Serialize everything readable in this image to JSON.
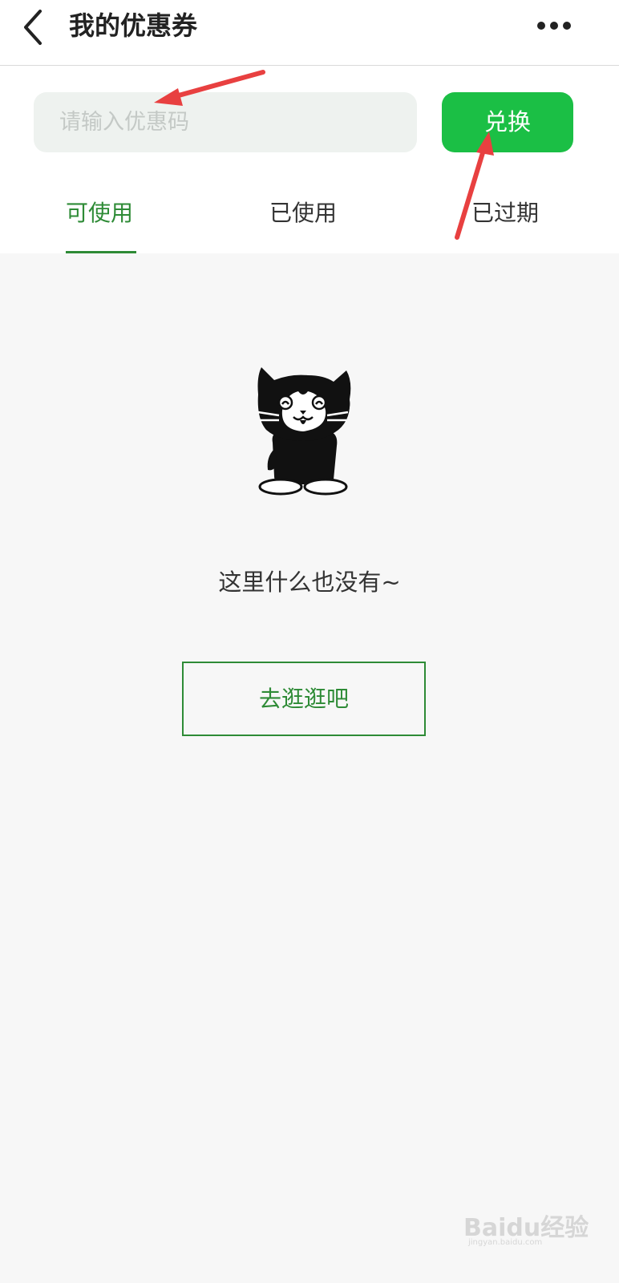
{
  "header": {
    "title": "我的优惠券",
    "back_icon": "chevron-left-icon",
    "more_icon": "more-dots-icon"
  },
  "redeem": {
    "placeholder": "请输入优惠码",
    "value": "",
    "button_label": "兑换"
  },
  "tabs": [
    {
      "label": "可使用",
      "active": true
    },
    {
      "label": "已使用",
      "active": false
    },
    {
      "label": "已过期",
      "active": false
    }
  ],
  "empty_state": {
    "illustration": "cat-illustration",
    "message": "这里什么也没有~",
    "button_label": "去逛逛吧"
  },
  "colors": {
    "accent_green": "#2e8b36",
    "button_green": "#1bbf45",
    "input_bg": "#eef2ef",
    "page_bg": "#f7f7f7",
    "annotation_red": "#e84040"
  },
  "watermark": {
    "text": "Baidu经验",
    "sub": "jingyan.baidu.com"
  }
}
